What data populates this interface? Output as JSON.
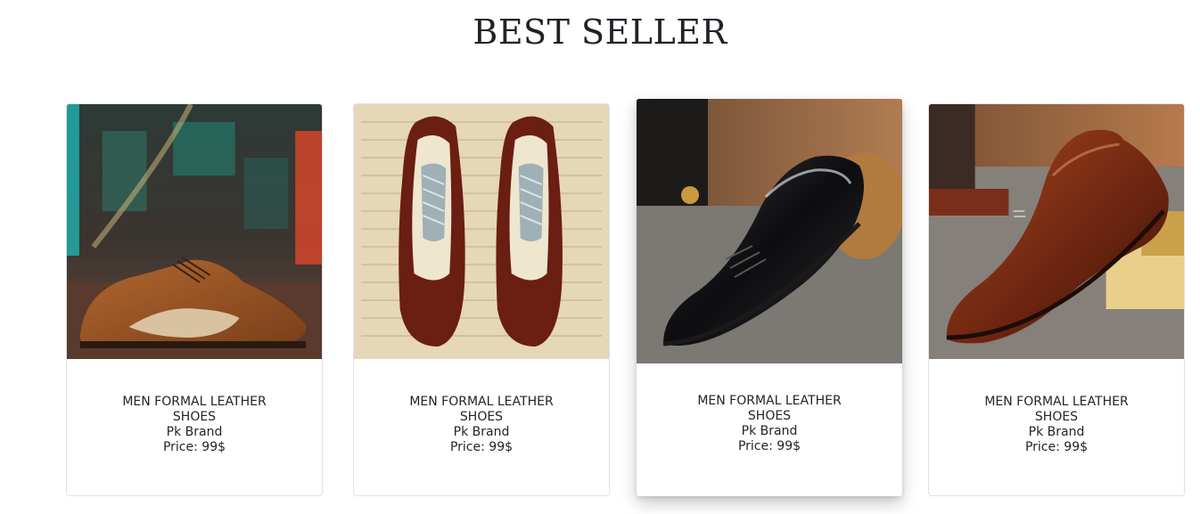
{
  "section": {
    "title": "BEST SELLER"
  },
  "products": [
    {
      "name": "MEN FORMAL LEATHER SHOES",
      "brand": "Pk Brand",
      "price": "Price: 99$",
      "image": "brown-wingtip-oxford-shoe"
    },
    {
      "name": "MEN FORMAL LEATHER SHOES",
      "brand": "Pk Brand",
      "price": "Price: 99$",
      "image": "two-tone-brogue-pair"
    },
    {
      "name": "MEN FORMAL LEATHER SHOES",
      "brand": "Pk Brand",
      "price": "Price: 99$",
      "image": "black-patent-leather-shoe"
    },
    {
      "name": "MEN FORMAL LEATHER SHOES",
      "brand": "Pk Brand",
      "price": "Price: 99$",
      "image": "brown-slip-on-loafer"
    }
  ]
}
